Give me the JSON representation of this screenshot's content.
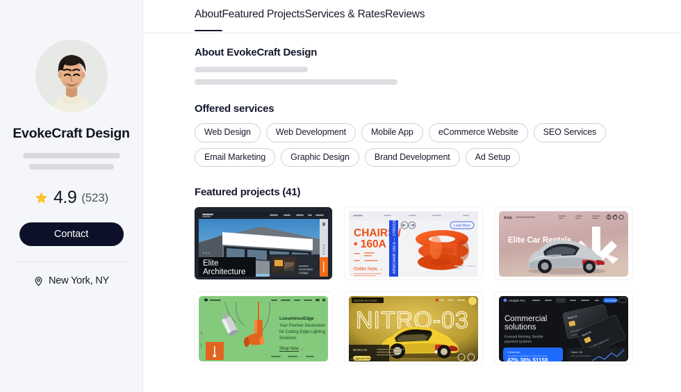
{
  "sidebar": {
    "avatar_alt": "profile-photo",
    "profile_name": "EvokeCraft Design",
    "rating": {
      "star_icon": "star-icon",
      "value": "4.9",
      "count": "(523)"
    },
    "contact_label": "Contact",
    "location": {
      "pin_icon": "map-pin-icon",
      "text": "New York, NY"
    }
  },
  "tabs": [
    {
      "label": "About",
      "active": true
    },
    {
      "label": "Featured Projects",
      "active": false
    },
    {
      "label": "Services & Rates",
      "active": false
    },
    {
      "label": "Reviews",
      "active": false
    }
  ],
  "about": {
    "heading": "About EvokeCraft Design"
  },
  "offered_services": {
    "heading": "Offered services",
    "chips": [
      "Web Design",
      "Web Development",
      "Mobile App",
      "eCommerce Website",
      "SEO Services",
      "Email Marketing",
      "Graphic Design",
      "Brand Development",
      "Ad Setup"
    ]
  },
  "featured_projects": {
    "heading": "Featured projects (41)",
    "count": 41,
    "cards": [
      {
        "name": "elite-architecture",
        "title": "Elite Architecture",
        "thumb_caption": "Greenlawn cottage",
        "accent": "#f26a15",
        "bg": "#2c3440"
      },
      {
        "name": "chairs-160a",
        "title": "CHAIRS /",
        "subtitle": "• 160A",
        "side_text": "ARMCHAIR 160.A — 178031504",
        "cta": "Order Now →",
        "badge": "Load More",
        "accent": "#f04e16",
        "bg": "#f4f4f6"
      },
      {
        "name": "elite-car-rentals",
        "title": "Elite Car Rentals.",
        "accent": "#ffffff",
        "bg": "#c9a8a4"
      },
      {
        "name": "luminousedge-lighting",
        "title": "LuxuminosEdge",
        "subtitle": "Your Premier Destination for Cutting Edge Lighting Solutions",
        "cta": "Shop Now →",
        "accent": "#e2641f",
        "bg": "#7fc978"
      },
      {
        "name": "nitro-03",
        "title": "NITRO-03",
        "tag": "NITRO-03",
        "accent": "#f2d24b",
        "bg": "#c9a93c"
      },
      {
        "name": "commercial-solutions",
        "title": "Commercial solutions",
        "subtitle": "Forward-thinking, flexible payment systems",
        "brand": "Analytix Pro",
        "cta": "Get Started",
        "accent": "#1f6bff",
        "bg": "#111316"
      }
    ]
  },
  "colors": {
    "sidebar_bg": "#f5f6f9",
    "text_primary": "#111322",
    "text_muted": "#50525e",
    "button_dark": "#0c1028",
    "star_gold": "#ffc327",
    "border": "#e4e6ec"
  }
}
